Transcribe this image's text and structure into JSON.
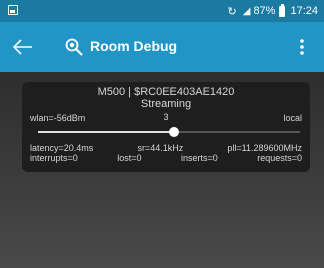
{
  "status_bar": {
    "sync_icon": "sync-icon",
    "signal_icon": "wifi-signal-icon",
    "battery_percent": "87%",
    "time": "17:24"
  },
  "app_bar": {
    "back_icon": "back-arrow-icon",
    "search_icon": "zoom-search-icon",
    "title": "Room Debug",
    "menu_icon": "more-vert-icon"
  },
  "card": {
    "device": "M500 | $RC0EE403AE1420",
    "state": "Streaming",
    "wlan": "wlan=-56dBm",
    "slider_value": "3",
    "slider_fraction": 0.52,
    "location": "local",
    "latency": "latency=20.4ms",
    "sample_rate": "sr=44.1kHz",
    "pll": "pll=11.289600MHz",
    "interrupts": "interrupts=0",
    "lost": "lost=0",
    "inserts": "inserts=0",
    "requests": "requests=0"
  },
  "colors": {
    "status_bar": "#1a7aa2",
    "app_bar": "#2196c6",
    "card_bg": "#1e1e1e"
  }
}
